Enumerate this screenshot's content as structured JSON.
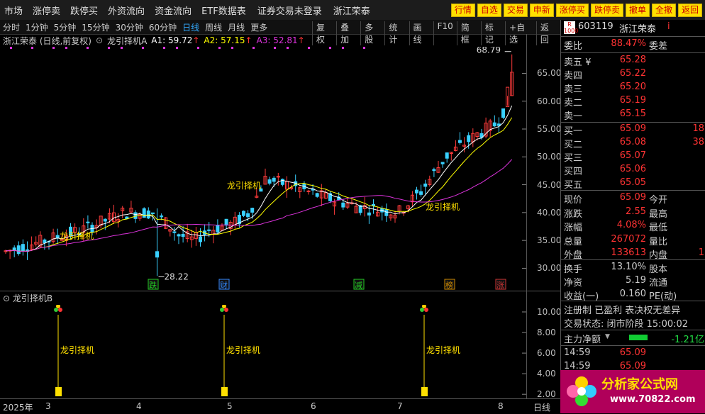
{
  "topbar": {
    "menu": [
      "市场",
      "涨停卖",
      "跌停买",
      "外资流向",
      "资金流向",
      "ETF数据表"
    ],
    "warn1": "证券交易未登录",
    "warn2": "浙江荣泰",
    "buttons": [
      "行情",
      "自选",
      "交易",
      "申新",
      "涨停买",
      "跌停卖",
      "撤单",
      "全撤",
      "返回"
    ]
  },
  "toolbar": {
    "periods": [
      "分时",
      "1分钟",
      "5分钟",
      "15分钟",
      "30分钟",
      "60分钟",
      "日线",
      "周线",
      "月线",
      "更多"
    ],
    "active_period": "日线",
    "tools": [
      "复权",
      "叠加",
      "多股",
      "统计",
      "画线",
      "F10",
      "简框",
      "标记",
      "+自选",
      "返回"
    ]
  },
  "legend": {
    "stock": "浙江荣泰 (日线,前复权)",
    "indicator": "龙引择机A",
    "a1": "A1: 59.72",
    "a2": "A2: 57.15",
    "a3": "A3: 52.81"
  },
  "chart_data": {
    "type": "candlestick",
    "y_ticks": [
      30,
      35,
      40,
      45,
      50,
      55,
      60,
      65
    ],
    "y_labels": [
      "30.00",
      "35.00",
      "40.00",
      "45.00",
      "50.00",
      "55.00",
      "60.00",
      "65.00"
    ],
    "ylim": [
      27,
      69
    ],
    "high_label": "68.79",
    "low_label": "28.22",
    "x_labels": [
      "2025年",
      "3",
      "4",
      "5",
      "6",
      "7",
      "8"
    ],
    "x_axis_right": "日线",
    "signal_text": "龙引择机",
    "markers": [
      "跌",
      "财",
      "减",
      "榜",
      "涨"
    ],
    "sub_title": "龙引择机B",
    "sub_y_labels": [
      "10.00",
      "8.00",
      "6.00",
      "4.00",
      "2.00"
    ]
  },
  "quote": {
    "code": "603119",
    "name": "浙江荣泰",
    "ratio_label": "委比",
    "ratio": "88.47%",
    "diff_label": "委差",
    "sell": [
      [
        "卖五 ¥",
        "65.28"
      ],
      [
        "卖四",
        "65.22"
      ],
      [
        "卖三",
        "65.20"
      ],
      [
        "卖二",
        "65.19"
      ],
      [
        "卖一",
        "65.15"
      ]
    ],
    "buy": [
      [
        "买一",
        "65.09",
        "18"
      ],
      [
        "买二",
        "65.08",
        "38"
      ],
      [
        "买三",
        "65.07",
        ""
      ],
      [
        "买四",
        "65.06",
        ""
      ],
      [
        "买五",
        "65.05",
        ""
      ]
    ],
    "stats": [
      [
        "现价",
        "65.09",
        "今开",
        ""
      ],
      [
        "涨跌",
        "2.55",
        "最高",
        ""
      ],
      [
        "涨幅",
        "4.08%",
        "最低",
        ""
      ],
      [
        "总量",
        "267072",
        "量比",
        ""
      ],
      [
        "外盘",
        "133613",
        "内盘",
        "1"
      ]
    ],
    "stats2": [
      [
        "换手",
        "13.10%",
        "股本"
      ],
      [
        "净资",
        "5.19",
        "流通"
      ],
      [
        "收益(一)",
        "0.160",
        "PE(动)"
      ]
    ],
    "info1": "注册制 已盈利 表决权无差异",
    "info2": "交易状态: 闭市阶段 15:00:02",
    "flow_label": "主力净额",
    "flow_value": "-1.21亿",
    "ticks": [
      [
        "14:59",
        "65.09"
      ],
      [
        "14:59",
        "65.09"
      ]
    ]
  },
  "brand": {
    "name": "分析家公式网",
    "url": "www.70822.com"
  }
}
